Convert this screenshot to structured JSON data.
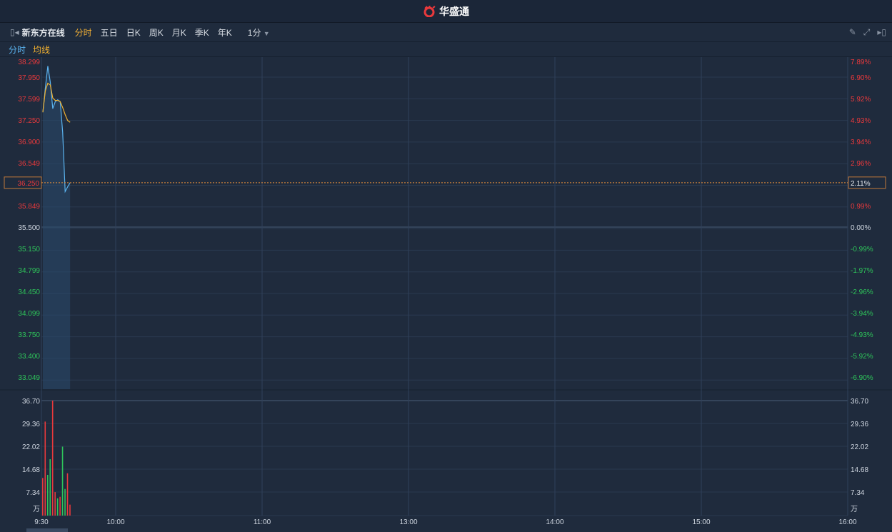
{
  "app": {
    "title": "华盛通"
  },
  "toolbar": {
    "stock_name": "新东方在线",
    "tabs": [
      "分时",
      "五日",
      "日K",
      "周K",
      "月K",
      "季K",
      "年K"
    ],
    "active": "分时",
    "interval": "1分"
  },
  "legend": {
    "price": "分时",
    "avg": "均线"
  },
  "colors": {
    "up": "#e8393c",
    "down": "#2ec45a",
    "price_line": "#5bb4f0",
    "avg_line": "#f0b030",
    "bg": "#1f2b3d"
  },
  "chart_data": {
    "type": "line",
    "prev_close": 35.5,
    "price_ticks": [
      "38.299",
      "37.950",
      "37.599",
      "37.250",
      "36.900",
      "36.549",
      "36.250",
      "35.849",
      "35.500",
      "35.150",
      "34.799",
      "34.450",
      "34.099",
      "33.750",
      "33.400",
      "33.049"
    ],
    "pct_ticks": [
      "7.89%",
      "6.90%",
      "5.92%",
      "4.93%",
      "3.94%",
      "2.96%",
      "2.11%",
      "0.99%",
      "0.00%",
      "-0.99%",
      "-1.97%",
      "-2.96%",
      "-3.94%",
      "-4.93%",
      "-5.92%",
      "-6.90%"
    ],
    "current_price": "36.250",
    "current_pct": "2.11%",
    "price": [
      37.44,
      37.85,
      38.22,
      37.95,
      37.5,
      37.62,
      37.65,
      37.62,
      37.1,
      36.1,
      36.18,
      36.25
    ],
    "avg": [
      37.44,
      37.8,
      37.93,
      37.9,
      37.68,
      37.64,
      37.64,
      37.62,
      37.52,
      37.4,
      37.3,
      37.27
    ],
    "volume_ticks": [
      "36.70",
      "29.36",
      "22.02",
      "14.68",
      "7.34"
    ],
    "volume_unit": "万",
    "volume": [
      12,
      30,
      13,
      18,
      36.7,
      7.5,
      5.5,
      6,
      22,
      8.5,
      13.5,
      3.5
    ],
    "volume_dir": [
      "up",
      "up",
      "down",
      "down",
      "up",
      "up",
      "down",
      "up",
      "down",
      "down",
      "up",
      "up"
    ],
    "time_ticks": [
      "9:30",
      "10:00",
      "11:00",
      "13:00",
      "14:00",
      "15:00",
      "16:00"
    ]
  }
}
